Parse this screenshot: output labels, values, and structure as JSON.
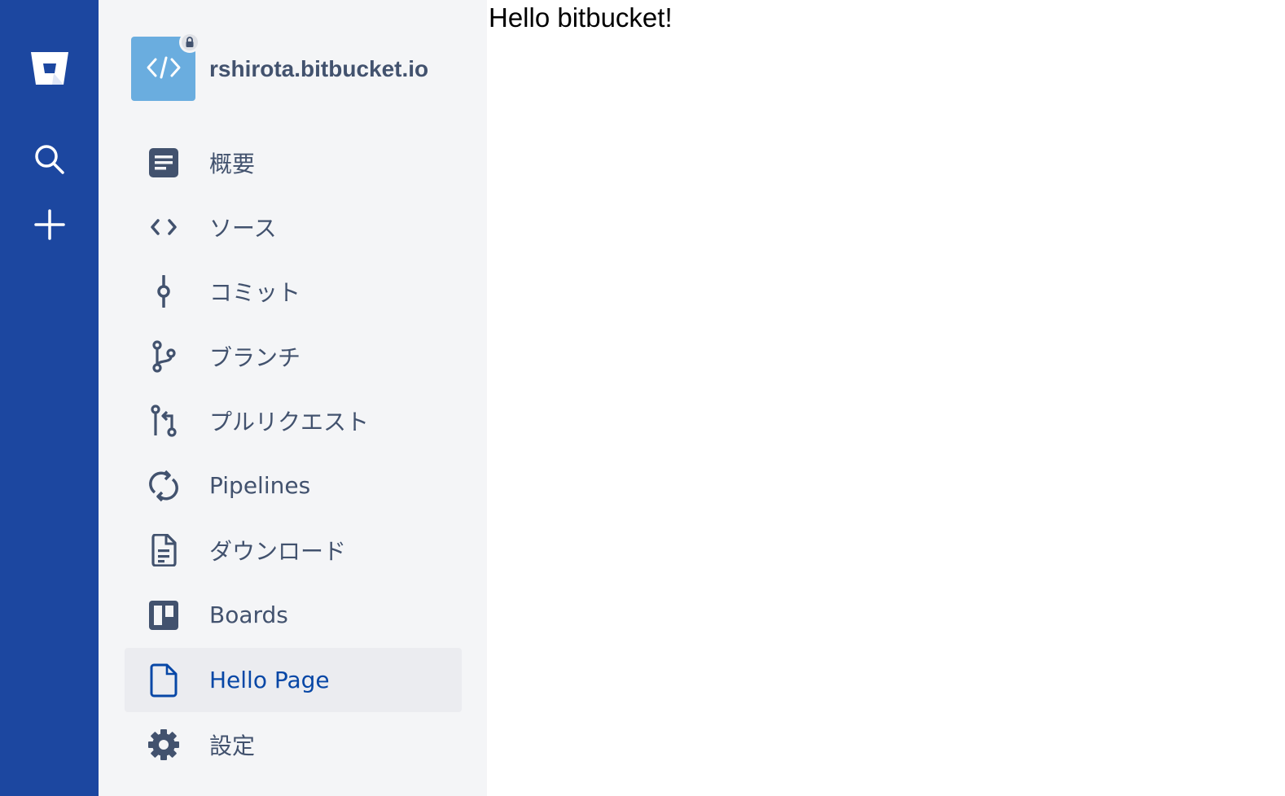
{
  "global_nav": {
    "logo_icon": "bitbucket-logo-icon",
    "search_icon": "search-icon",
    "create_icon": "plus-icon",
    "background": "#1c47a0"
  },
  "repo": {
    "name": "rshirota.bitbucket.io",
    "avatar_icon": "code-icon",
    "avatar_color": "#6aaddf",
    "private_icon": "lock-icon"
  },
  "sidebar": {
    "items": [
      {
        "label": "概要",
        "icon": "overview-icon",
        "selected": false
      },
      {
        "label": "ソース",
        "icon": "source-icon",
        "selected": false
      },
      {
        "label": "コミット",
        "icon": "commit-icon",
        "selected": false
      },
      {
        "label": "ブランチ",
        "icon": "branch-icon",
        "selected": false
      },
      {
        "label": "プルリクエスト",
        "icon": "pull-request-icon",
        "selected": false
      },
      {
        "label": "Pipelines",
        "icon": "pipelines-icon",
        "selected": false
      },
      {
        "label": "ダウンロード",
        "icon": "download-icon",
        "selected": false
      },
      {
        "label": "Boards",
        "icon": "boards-icon",
        "selected": false
      },
      {
        "label": "Hello Page",
        "icon": "page-icon",
        "selected": true
      },
      {
        "label": "設定",
        "icon": "settings-icon",
        "selected": false
      }
    ]
  },
  "main": {
    "heading": "Hello bitbucket!"
  },
  "colors": {
    "sidebar_bg": "#f4f5f7",
    "nav_text": "#42526e",
    "selected_text": "#0747a6",
    "selected_bg": "#ebecf0"
  }
}
